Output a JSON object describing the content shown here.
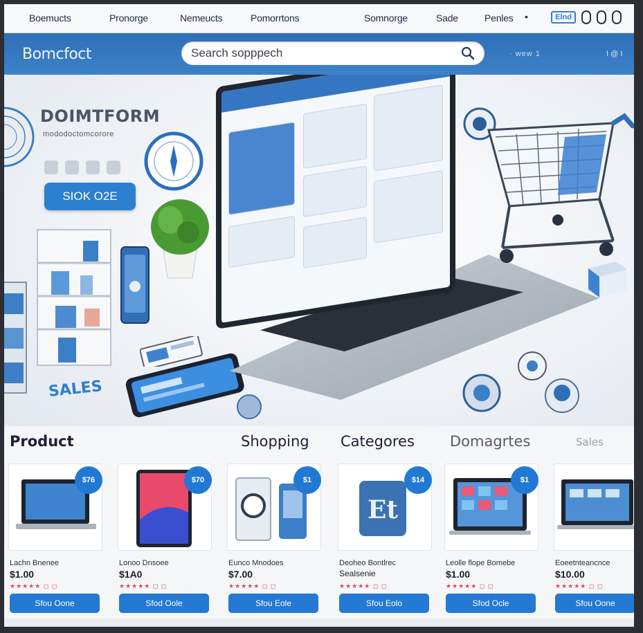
{
  "topnav": {
    "links": [
      "Boemucts",
      "Pronorge",
      "Nemeucts",
      "Pomorrtons",
      "Somnorge",
      "Sade",
      "Penles"
    ],
    "flag_label": "Elnd"
  },
  "header": {
    "brand": "Bomcfoct",
    "search_placeholder": "Search sopppech",
    "meta_left": "·  wew 1",
    "meta_right": "I  @ I"
  },
  "hero": {
    "title": "DOIMTFORM",
    "subtitle": "mododoctomcorore",
    "cta_label": "SIOK O2E",
    "sales_label": "SALES"
  },
  "sections": {
    "product": "Product",
    "shopping": "Shopping",
    "categories": "Categores",
    "domagres": "Domagrtes",
    "sales": "Sales"
  },
  "products": [
    {
      "badge": "$76",
      "name": "Lachn Bnenee",
      "price": "$1.00",
      "stars": "★★★★★ ◻ ◻",
      "button": "Sfou Oone"
    },
    {
      "badge": "$70",
      "name": "Lonoo Dnsoee",
      "price": "$1A0",
      "stars": "★★★★★ ◻ ◻",
      "button": "Sfod Oole"
    },
    {
      "badge": "$1",
      "name": "Eunco Mnodoes",
      "price": "$7.00",
      "stars": "★★★★★ ◻ ◻",
      "button": "Sfou Eole"
    },
    {
      "badge": "$14",
      "name": "Deoheo Bontlrec",
      "price": "Sealsenie",
      "stars": "★★★★★ ◻ ◻",
      "button": "Sfou Eolo"
    },
    {
      "badge": "$1",
      "name": "Leolle flope Bomebe",
      "price": "$1.00",
      "stars": "★★★★★ ◻ ◻",
      "button": "Sfod Ocle"
    },
    {
      "badge": "",
      "name": "Eoeetnteancnce",
      "price": "$10.00",
      "stars": "★★★★★ ◻ ◻",
      "button": "Sfou Oone"
    }
  ],
  "colors": {
    "brand_blue": "#2f6fb8",
    "button_blue": "#2479d2",
    "badge_blue": "#2279d4"
  }
}
